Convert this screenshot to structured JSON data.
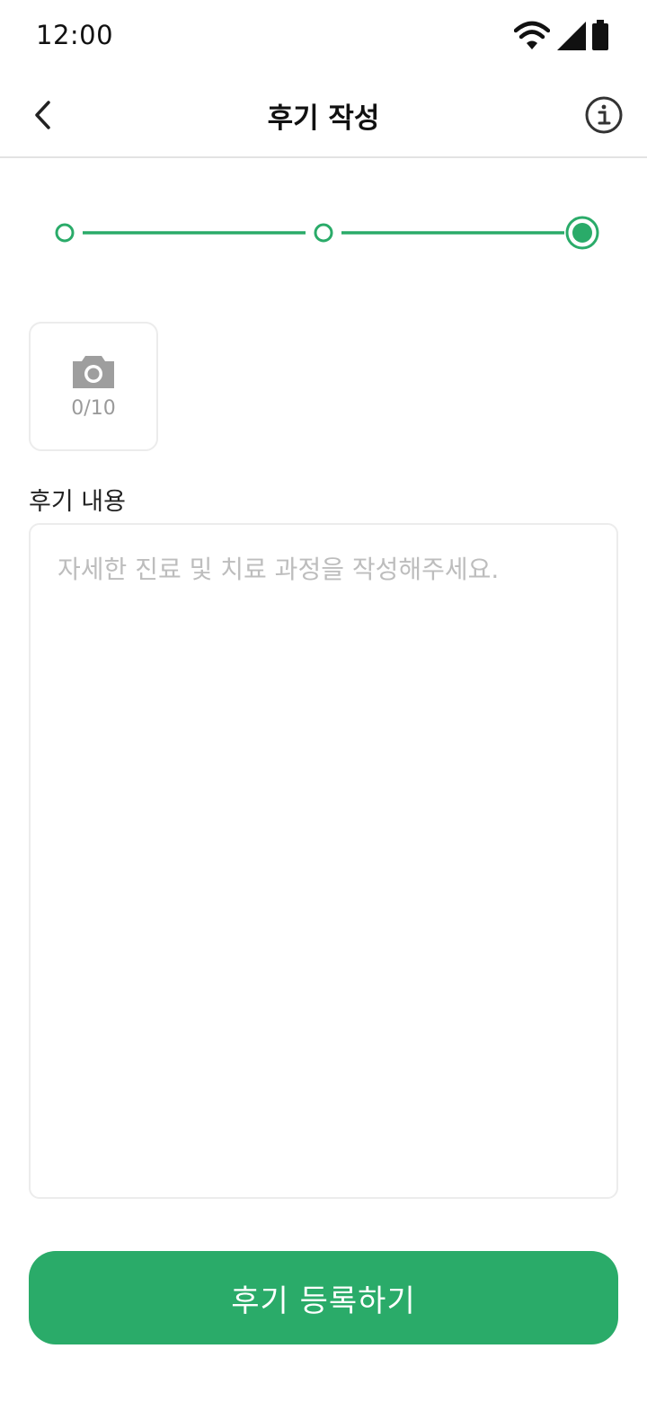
{
  "status_bar": {
    "time": "12:00",
    "icons": [
      "wifi-icon",
      "cellular-signal-icon",
      "battery-icon"
    ]
  },
  "app_bar": {
    "title": "후기 작성",
    "back_icon": "chevron-left-icon",
    "info_icon": "info-circle-icon"
  },
  "stepper": {
    "total_steps": 3,
    "current_step": 3
  },
  "photo_upload": {
    "icon": "camera-icon",
    "count": "0/10"
  },
  "review": {
    "label": "후기 내용",
    "value": "",
    "placeholder": "자세한 진료 및 치료 과정을 작성해주세요."
  },
  "submit": {
    "label": "후기 등록하기"
  },
  "colors": {
    "accent": "#2aab69",
    "border": "#ececec",
    "placeholder": "#bdbdbd",
    "muted": "#9a9a9a"
  }
}
